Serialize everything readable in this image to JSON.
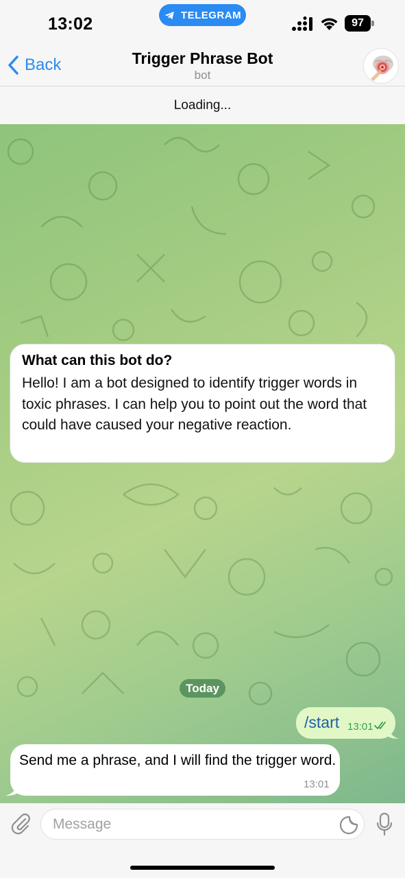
{
  "status_bar": {
    "time": "13:02",
    "app_pill": "TELEGRAM",
    "battery": "97"
  },
  "header": {
    "back_label": "Back",
    "title": "Trigger Phrase Bot",
    "subtitle": "bot"
  },
  "loading_text": "Loading...",
  "intro_card": {
    "heading": "What can this bot do?",
    "body": "Hello! I am a bot designed to identify trigger words in toxic phrases. I can help you to point out the word that could have caused your negative reaction."
  },
  "date_separator": "Today",
  "messages": [
    {
      "direction": "outgoing",
      "text": "/start",
      "time": "13:01",
      "status": "read"
    },
    {
      "direction": "incoming",
      "text": "Send me a phrase, and I will find the trigger word.",
      "time": "13:01"
    }
  ],
  "composer": {
    "placeholder": "Message"
  },
  "colors": {
    "accent": "#2a8bf2",
    "outgoing_bubble": "#e1f8c6",
    "wallpaper": "#a4cc82"
  },
  "icons": {
    "back": "chevron-left-icon",
    "attach": "paperclip-icon",
    "sticker": "sticker-icon",
    "mic": "microphone-icon"
  }
}
